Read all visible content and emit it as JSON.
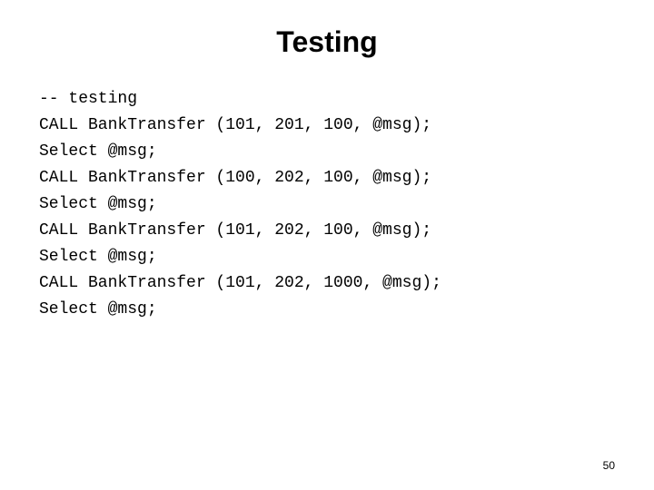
{
  "slide": {
    "title": "Testing",
    "code_lines": [
      "-- testing",
      "CALL BankTransfer (101, 201, 100, @msg);",
      "Select @msg;",
      "CALL BankTransfer (100, 202, 100, @msg);",
      "Select @msg;",
      "CALL BankTransfer (101, 202, 100, @msg);",
      "Select @msg;",
      "CALL BankTransfer (101, 202, 1000, @msg);",
      "Select @msg;"
    ],
    "page_number": "50"
  }
}
